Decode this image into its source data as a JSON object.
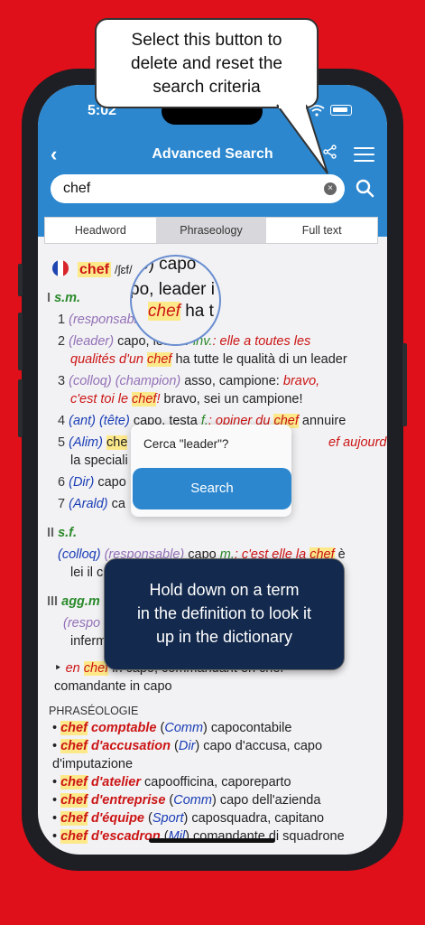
{
  "status": {
    "time": "5:02"
  },
  "header": {
    "back_icon": "‹",
    "title": "Advanced Search",
    "share_icon": "share-icon",
    "menu_icon": "hamburger-icon"
  },
  "search": {
    "value": "chef",
    "placeholder": "",
    "clear_icon": "×"
  },
  "tabs": [
    {
      "label": "Headword"
    },
    {
      "label": "Phraseology"
    },
    {
      "label": "Full text"
    }
  ],
  "entry": {
    "headword": "chef",
    "pronunciation": "/ʃɛf/",
    "pos1": "s.m.",
    "pos2": "s.f.",
    "pos3": "agg.m",
    "senses": [
      {
        "num": "1",
        "tag": "(responsable)",
        "text": " capo"
      },
      {
        "num": "2",
        "tag": "(leader)",
        "text1": " capo, leader ",
        "inv": "inv.",
        "ex1": ": elle a toutes les",
        "ex2": "qualités d'un ",
        "hw": "chef",
        "tr": " ha tutte le qualità di un leader"
      },
      {
        "num": "3",
        "tag": "(colloq)",
        "tag2": "(champion)",
        "text1": " asso, campione: ",
        "ex1": "bravo,",
        "ex2": "c'est toi le ",
        "hw": "chef",
        "ex3": "!",
        "tr": " bravo, sei un campione!"
      },
      {
        "num": "4",
        "tag": "(ant)",
        "tag2": "(tête)",
        "text1": " capo, testa ",
        "f": "f.",
        "ex1": ": opiner du ",
        "hw": "chef",
        "tr": " annuire"
      },
      {
        "num": "5",
        "tag": "(Alim)",
        "hw": "che",
        "ex1": "ef aujourd'hui",
        "line2": "la speciali"
      },
      {
        "num": "6",
        "tag": "(Dir)",
        "text1": " capo"
      },
      {
        "num": "7",
        "tag": "(Arald)",
        "text1": " ca"
      }
    ],
    "sf": {
      "tag": "(colloq)",
      "tag2": "(responsable)",
      "text1": " capo ",
      "m": "m.",
      "ex1": ": c'est elle la ",
      "hw": "chef",
      "tail": " è",
      "line2": "lei il c"
    },
    "agg": {
      "tag": "(respo",
      "line2": "inferm"
    },
    "compound": {
      "bullet": "‣",
      "ex": "en ",
      "hw": "chef",
      "tail": " in capo; commandant en chef",
      "line2": "comandante in capo"
    },
    "phraseology_heading": "PHRASÉOLOGIE",
    "phrases": [
      {
        "hw": "chef",
        "rest": " comptable",
        "tag": "Comm",
        "tr": " capocontabile"
      },
      {
        "hw": "chef",
        "rest": " d'accusation",
        "tag": "Dir",
        "tr": " capo d'accusa, capo",
        "tr2": "d'imputazione"
      },
      {
        "hw": "chef",
        "rest": " d'atelier",
        "tag": "",
        "tr": " capoofficina, caporeparto"
      },
      {
        "hw": "chef",
        "rest": " d'entreprise",
        "tag": "Comm",
        "tr": " capo dell'azienda"
      },
      {
        "hw": "chef",
        "rest": " d'équipe",
        "tag": "Sport",
        "tr": " caposquadra, capitano"
      },
      {
        "hw": "chef",
        "rest": " d'escadron",
        "tag": "Mil",
        "tr": " comandante di squadrone"
      }
    ]
  },
  "lens": {
    "l1": "e) capo",
    "l2": "po, leader i",
    "l3a": "chef",
    "l3b": " ha t"
  },
  "popup": {
    "label": "Cerca \"leader\"?",
    "button": "Search"
  },
  "callout_top": {
    "l1": "Select this button to",
    "l2": "delete and reset the",
    "l3": "search criteria"
  },
  "callout_bottom": {
    "l1": "Hold down on a term",
    "l2": "in the definition to look it",
    "l3": "up in the dictionary"
  },
  "colors": {
    "brand_blue": "#2c87cf",
    "background_red": "#e0101b",
    "tip_navy": "#13294d",
    "headword_red": "#cc1515",
    "pos_green": "#2a8a2a"
  }
}
